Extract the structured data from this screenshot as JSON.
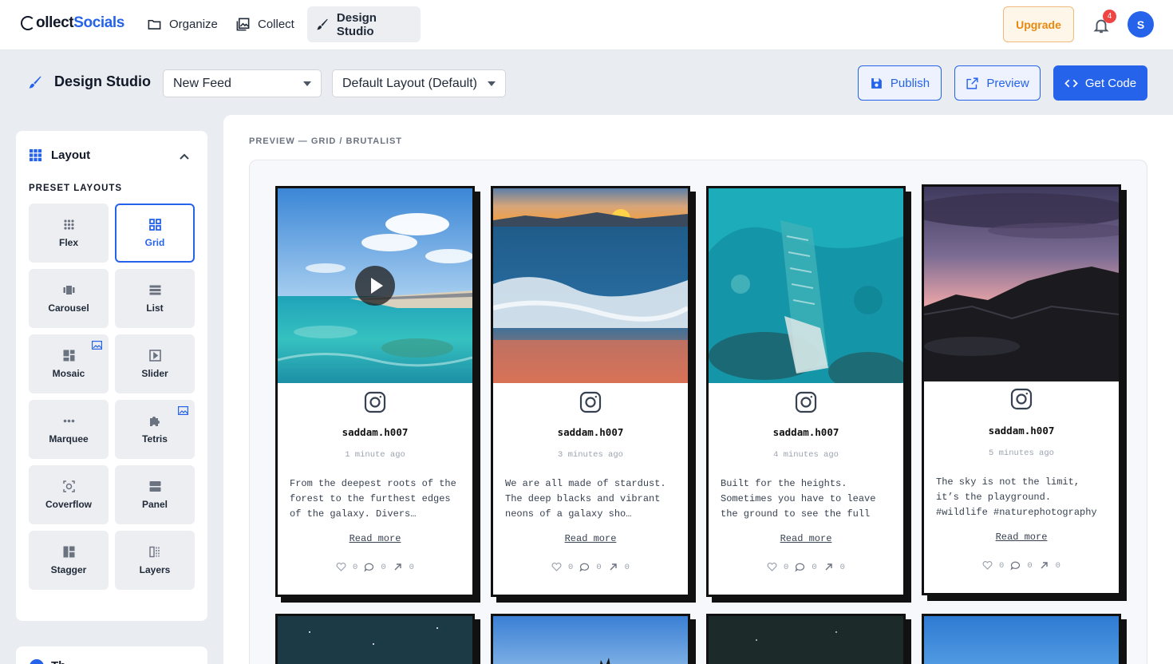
{
  "brand": {
    "logo_part1": "ollect",
    "logo_part2": "Socials"
  },
  "nav": {
    "items": [
      {
        "label": "Organize",
        "icon": "folder-icon"
      },
      {
        "label": "Collect",
        "icon": "gallery-icon"
      },
      {
        "label": "Design Studio",
        "icon": "brush-icon",
        "active": true
      }
    ],
    "upgrade_label": "Upgrade",
    "notification_count": "4",
    "avatar_initial": "S"
  },
  "toolbar": {
    "title": "Design Studio",
    "feed_select": "New Feed",
    "layout_select": "Default Layout (Default)",
    "publish_label": "Publish",
    "preview_label": "Preview",
    "get_code_label": "Get Code"
  },
  "sidebar": {
    "section_title": "Layout",
    "subtitle": "PRESET LAYOUTS",
    "layouts": [
      {
        "label": "Flex",
        "icon": "dots-grid-icon",
        "active": false,
        "pro": false
      },
      {
        "label": "Grid",
        "icon": "grid-icon",
        "active": true,
        "pro": false
      },
      {
        "label": "Carousel",
        "icon": "carousel-icon",
        "active": false,
        "pro": false
      },
      {
        "label": "List",
        "icon": "list-icon",
        "active": false,
        "pro": false
      },
      {
        "label": "Mosaic",
        "icon": "mosaic-icon",
        "active": false,
        "pro": true
      },
      {
        "label": "Slider",
        "icon": "slider-icon",
        "active": false,
        "pro": false
      },
      {
        "label": "Marquee",
        "icon": "marquee-icon",
        "active": false,
        "pro": false
      },
      {
        "label": "Tetris",
        "icon": "puzzle-icon",
        "active": false,
        "pro": true
      },
      {
        "label": "Coverflow",
        "icon": "coverflow-icon",
        "active": false,
        "pro": false
      },
      {
        "label": "Panel",
        "icon": "panel-icon",
        "active": false,
        "pro": false
      },
      {
        "label": "Stagger",
        "icon": "stagger-icon",
        "active": false,
        "pro": false
      },
      {
        "label": "Layers",
        "icon": "layers-icon",
        "active": false,
        "pro": false
      }
    ],
    "next_section_title": "Th"
  },
  "preview": {
    "label": "PREVIEW — GRID / BRUTALIST",
    "posts": [
      {
        "username": "saddam.h007",
        "time": "1 minute ago",
        "caption": "From the deepest roots of the forest to the furthest edges of the galaxy. Divers…",
        "read_more": "Read more",
        "likes": "0",
        "comments": "0",
        "shares": "0",
        "has_video": true,
        "image": "beach-aerial"
      },
      {
        "username": "saddam.h007",
        "time": "3 minutes ago",
        "caption": "We are all made of stardust. The deep blacks and vibrant neons of a galaxy sho…",
        "read_more": "Read more",
        "likes": "0",
        "comments": "0",
        "shares": "0",
        "has_video": false,
        "image": "sunset-waves"
      },
      {
        "username": "saddam.h007",
        "time": "4 minutes ago",
        "caption": "Built for the heights. Sometimes you have to leave the ground to see the full pic…",
        "read_more": "Read more",
        "likes": "0",
        "comments": "0",
        "shares": "0",
        "has_video": false,
        "image": "reef-aerial"
      },
      {
        "username": "saddam.h007",
        "time": "5 minutes ago",
        "caption": "The sky is not the limit, it’s the playground. #wildlife #naturephotography #fli…",
        "read_more": "Read more",
        "likes": "0",
        "comments": "0",
        "shares": "0",
        "has_video": false,
        "image": "mountain-dusk"
      }
    ]
  },
  "colors": {
    "accent": "#2563eb",
    "upgrade": "#e8890f",
    "badge": "#ef4444"
  }
}
